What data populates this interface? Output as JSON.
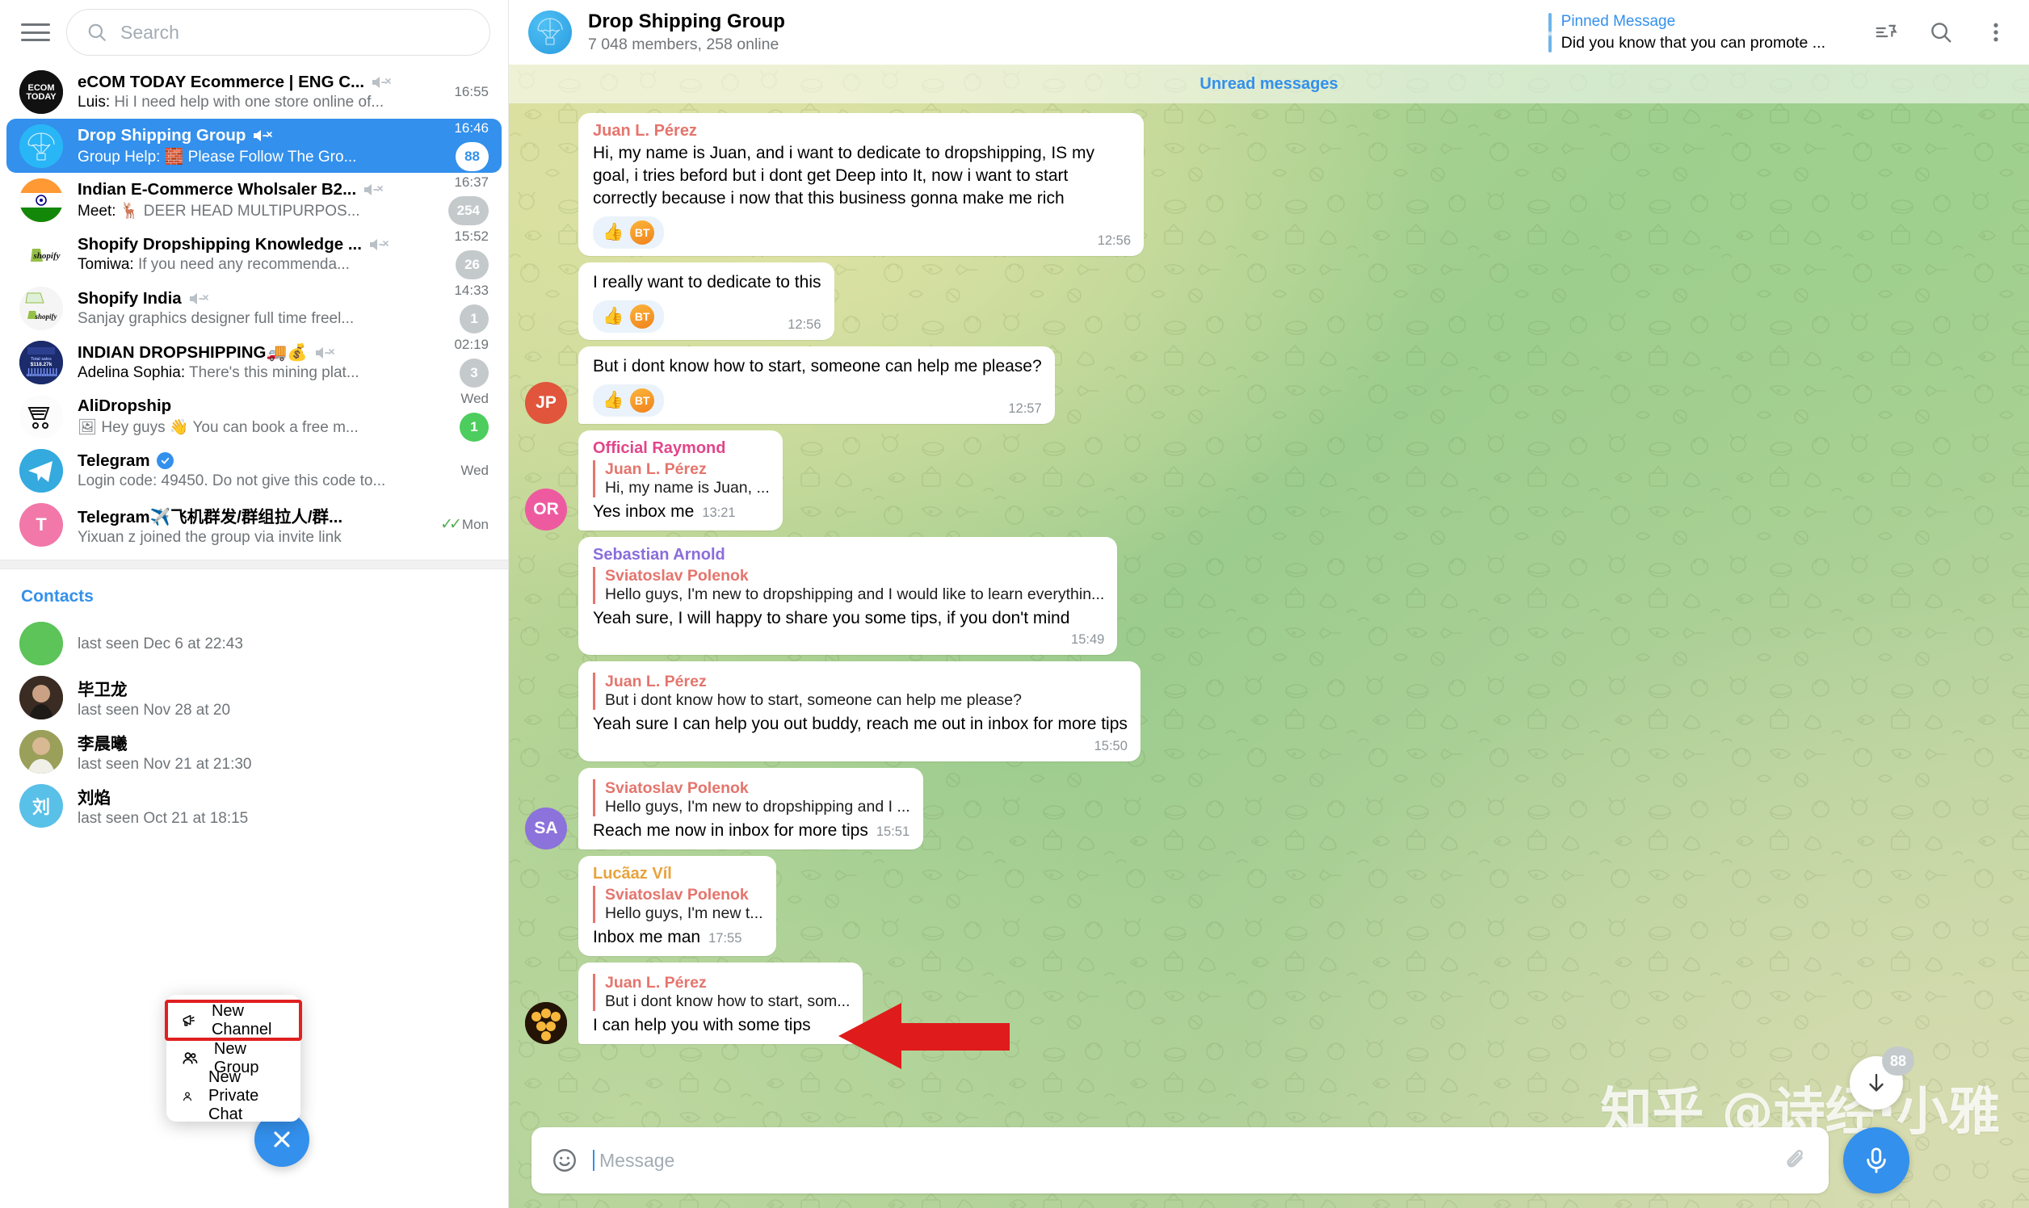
{
  "sidebar": {
    "search": {
      "placeholder": "Search"
    },
    "chats": [
      {
        "title": "eCOM TODAY Ecommerce | ENG C...",
        "sender": "Luis:",
        "preview": " Hi I need help with one store online of...",
        "time": "16:55",
        "muted": true,
        "badge": "",
        "badge_style": "",
        "avatar_text": "",
        "avatar_color": "#121212"
      },
      {
        "title": "Drop Shipping Group",
        "sender": "Group Help:",
        "preview": " 🧱 Please Follow The Gro...",
        "time": "16:46",
        "muted": true,
        "badge": "88",
        "badge_style": "white",
        "avatar_text": "",
        "avatar_color": "#29b6f6"
      },
      {
        "title": "Indian E-Commerce Wholsaler B2...",
        "sender": "Meet:",
        "preview": " 🦌 DEER HEAD MULTIPURPOS...",
        "time": "16:37",
        "muted": true,
        "badge": "254",
        "badge_style": "",
        "avatar_text": "",
        "avatar_color": "#ff9933"
      },
      {
        "title": "Shopify Dropshipping Knowledge ...",
        "sender": "Tomiwa:",
        "preview": " If you need any recommenda...",
        "time": "15:52",
        "muted": true,
        "badge": "26",
        "badge_style": "",
        "avatar_text": "",
        "avatar_color": "#ffffff"
      },
      {
        "title": "Shopify India",
        "sender": "",
        "preview": "Sanjay graphics designer full time freel...",
        "time": "14:33",
        "muted": true,
        "badge": "1",
        "badge_style": "",
        "avatar_text": "",
        "avatar_color": "#f4f4f4"
      },
      {
        "title": "INDIAN DROPSHIPPING🚚💰",
        "sender": "Adelina Sophia:",
        "preview": " There's this mining plat...",
        "time": "02:19",
        "muted": true,
        "badge": "3",
        "badge_style": "",
        "avatar_text": "",
        "avatar_color": "#1b2b6b"
      },
      {
        "title": "AliDropship",
        "sender": "",
        "preview": "🖼 Hey guys 👋 You can book a free m...",
        "time": "Wed",
        "muted": false,
        "badge": "1",
        "badge_style": "green",
        "avatar_text": "",
        "avatar_color": "#fafafa"
      },
      {
        "title": "Telegram",
        "sender": "",
        "preview": "Login code: 49450. Do not give this code to...",
        "time": "Wed",
        "muted": false,
        "badge": "",
        "badge_style": "",
        "verified": true,
        "avatar_text": "",
        "avatar_color": "#34aadf"
      },
      {
        "title": "Telegram✈️飞机群发/群组拉人/群...",
        "sender": "",
        "preview": "Yixuan z joined the group via invite link",
        "time": "Mon",
        "muted": false,
        "badge": "",
        "badge_style": "",
        "read": true,
        "avatar_text": "T",
        "avatar_color": "#f178a8"
      }
    ],
    "contacts_header": "Contacts",
    "contacts": [
      {
        "name": "",
        "status": "last seen Dec 6 at 22:43",
        "avatar_text": "",
        "avatar_color": "#5cc459"
      },
      {
        "name": "毕卫龙",
        "status": "last seen Nov 28 at 20",
        "avatar_text": "",
        "avatar_color": "#4a3a30"
      },
      {
        "name": "李晨曦",
        "status": "last seen Nov 21 at 21:30",
        "avatar_text": "",
        "avatar_color": "#8a8f55"
      },
      {
        "name": "刘焰",
        "status": "last seen Oct 21 at 18:15",
        "avatar_text": "刘",
        "avatar_color": "#59c0e8"
      }
    ],
    "context_menu": [
      {
        "label": "New Channel",
        "icon": "megaphone-icon",
        "highlighted": true
      },
      {
        "label": "New Group",
        "icon": "people-icon",
        "highlighted": false
      },
      {
        "label": "New Private Chat",
        "icon": "person-icon",
        "highlighted": false
      }
    ],
    "fab_label": "close-icon"
  },
  "header": {
    "title": "Drop Shipping Group",
    "subtitle": "7 048 members, 258 online",
    "pinned_label": "Pinned Message",
    "pinned_text": "Did you know that you can promote ...",
    "icons": [
      "pinned-list-icon",
      "search-icon",
      "more-menu-icon"
    ]
  },
  "chat": {
    "unread_divider": "Unread messages",
    "messages": [
      {
        "author": "Juan L. Pérez",
        "author_color": "#e4756d",
        "text": "Hi, my name is Juan, and i want to dedicate to dropshipping, IS my goal, i tries beford but i dont get Deep into It, now i want to start correctly because i now that this business gonna make me rich",
        "time": "12:56",
        "reactions": [
          "👍",
          "BT"
        ],
        "avatar_text": "",
        "avatar_color": "",
        "show_avatar": false
      },
      {
        "author": "",
        "text": "I really want to dedicate to this",
        "time": "12:56",
        "reactions": [
          "👍",
          "BT"
        ],
        "show_avatar": false
      },
      {
        "author": "",
        "text": "But i dont know how to start, someone can help me please?",
        "time": "12:57",
        "reactions": [
          "👍",
          "BT"
        ],
        "avatar_text": "JP",
        "avatar_color": "#e0553c",
        "show_avatar": true
      },
      {
        "author": "Official Raymond",
        "author_color": "#e1468a",
        "reply_name": "Juan L. Pérez",
        "reply_text": "Hi, my name is Juan, ...",
        "text": "Yes inbox me",
        "time": "13:21",
        "time_inline": true,
        "avatar_text": "OR",
        "avatar_color": "#ee5aa0",
        "show_avatar": true
      },
      {
        "author": "Sebastian Arnold",
        "author_color": "#8a6ddb",
        "reply_name": "Sviatoslav Polenok",
        "reply_text": "Hello guys, I'm new to dropshipping and I would like to learn everythin...",
        "text": "Yeah sure, I will happy to share you some tips, if you don't mind",
        "time": "15:49",
        "show_avatar": false
      },
      {
        "author": "",
        "reply_name": "Juan L. Pérez",
        "reply_text": "But i dont know how to start, someone can help me please?",
        "text": "Yeah sure I can help you out buddy, reach me out in inbox for more tips",
        "time": "15:50",
        "show_avatar": false
      },
      {
        "author": "",
        "reply_name": "Sviatoslav Polenok",
        "reply_text": "Hello guys, I'm new to dropshipping and I ...",
        "text": "Reach me now in inbox for more tips",
        "time": "15:51",
        "time_inline": true,
        "avatar_text": "SA",
        "avatar_color": "#8c72db",
        "show_avatar": true
      },
      {
        "author": "Lucãaz Víl",
        "author_color": "#e8a33d",
        "reply_name": "Sviatoslav Polenok",
        "reply_text": "Hello guys, I'm new t...",
        "text": "Inbox me man",
        "time": "17:55",
        "time_inline": true,
        "show_avatar": false
      },
      {
        "author": "",
        "reply_name": "Juan L. Pérez",
        "reply_text": "But i dont know how to start, som...",
        "text": "I can help you with some tips",
        "time": "",
        "avatar_text": "",
        "avatar_color": "#2c1a08",
        "show_avatar": true
      }
    ]
  },
  "composer": {
    "placeholder": "Message",
    "emoji_icon": "smiley-icon",
    "attach_icon": "paperclip-icon",
    "mic_icon": "microphone-icon"
  },
  "scroll_button": {
    "badge": "88",
    "icon": "arrow-down-icon"
  },
  "watermark": {
    "text": "知乎 @诗经·小雅"
  },
  "annotation": {
    "arrow": "red-left-arrow",
    "color": "#e01b1b"
  }
}
